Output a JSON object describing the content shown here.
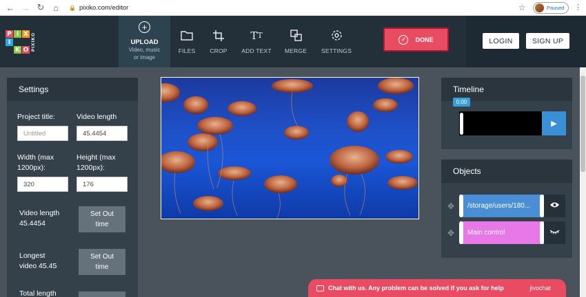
{
  "browser": {
    "url": "pixiko.com/editor",
    "profile_status": "Paused"
  },
  "logo": {
    "letters": [
      "P",
      "I",
      "X",
      "I",
      "K",
      "O"
    ],
    "side_text": "PIXIKO",
    "colors": [
      "#e84b62",
      "#8cc63f",
      "#f7941d",
      "#29abe2",
      "#8cc63f",
      "#e84b62"
    ]
  },
  "toolbar": {
    "upload_label": "UPLOAD",
    "upload_sub_1": "Video, music",
    "upload_sub_2": "or image",
    "tools": [
      {
        "label": "FILES",
        "icon": "folder-icon"
      },
      {
        "label": "CROP",
        "icon": "crop-icon"
      },
      {
        "label": "ADD TEXT",
        "icon": "text-icon"
      },
      {
        "label": "MERGE",
        "icon": "merge-icon"
      },
      {
        "label": "SETTINGS",
        "icon": "gear-icon"
      }
    ],
    "done_label": "DONE",
    "login_label": "LOGIN",
    "signup_label": "SIGN UP"
  },
  "settings": {
    "title": "Settings",
    "project_title_label": "Project title:",
    "project_title_placeholder": "Untitled",
    "video_length_label": "Video length",
    "video_length_value": "45.4454",
    "width_label_1": "Width (max",
    "width_label_2": "1200px):",
    "width_value": "320",
    "height_label_1": "Height (max",
    "height_label_2": "1200px):",
    "height_value": "176",
    "info1_label": "Video length",
    "info1_value": "45.4454",
    "info2_label": "Longest",
    "info2_value": "video 45.45",
    "info3_label": "Total length",
    "set_out_1": "Set Out",
    "set_out_2": "time"
  },
  "timeline": {
    "title": "Timeline",
    "time": "0.00"
  },
  "objects": {
    "title": "Objects",
    "items": [
      {
        "label": "/storage/users/180...",
        "color": "#4a8fd6"
      },
      {
        "label": "Main control",
        "color": "#e877e8"
      }
    ]
  },
  "chat": {
    "message": "Chat with us. Any problem can be solved if you ask for help",
    "brand": "jivochat"
  },
  "colors": {
    "accent": "#e84b62",
    "toolbar_bg": "#23303a",
    "panel_bg": "#35414a"
  }
}
